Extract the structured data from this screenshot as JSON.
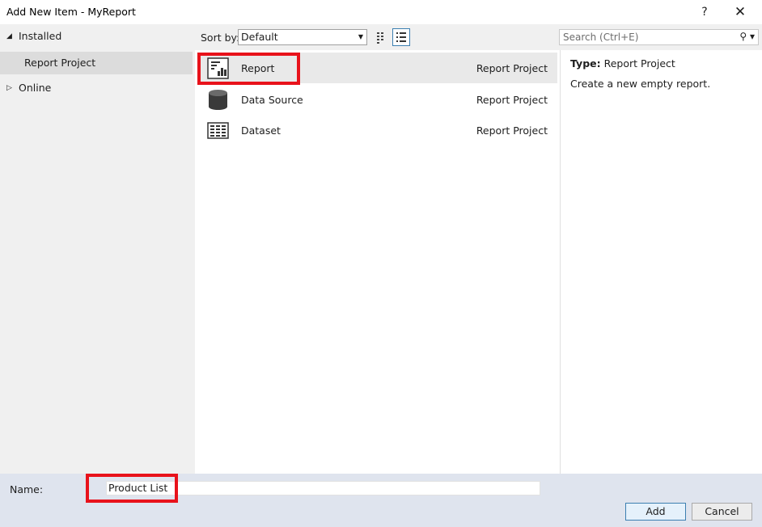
{
  "window": {
    "title": "Add New Item - MyReport",
    "help_label": "?",
    "close_label": "✕"
  },
  "sidebar": {
    "installed_label": "Installed",
    "installed_arrow": "◢",
    "selected_child": "Report Project",
    "online_label": "Online",
    "online_arrow": "▷"
  },
  "toolbar": {
    "sort_label": "Sort by:",
    "sort_value": "Default",
    "search_placeholder": "Search (Ctrl+E)"
  },
  "items": [
    {
      "name": "Report",
      "category": "Report Project",
      "icon": "report-icon",
      "selected": true
    },
    {
      "name": "Data Source",
      "category": "Report Project",
      "icon": "database-icon",
      "selected": false
    },
    {
      "name": "Dataset",
      "category": "Report Project",
      "icon": "dataset-icon",
      "selected": false
    }
  ],
  "details": {
    "type_label": "Type:",
    "type_value": "Report Project",
    "description": "Create a new empty report."
  },
  "footer": {
    "name_label": "Name:",
    "name_value": "Product List",
    "add_label": "Add",
    "cancel_label": "Cancel"
  },
  "colors": {
    "highlight": "#e8121b",
    "accent": "#3c7fb1",
    "bottom_bg": "#dfe4ee",
    "selected_row": "#e9e9e9"
  }
}
